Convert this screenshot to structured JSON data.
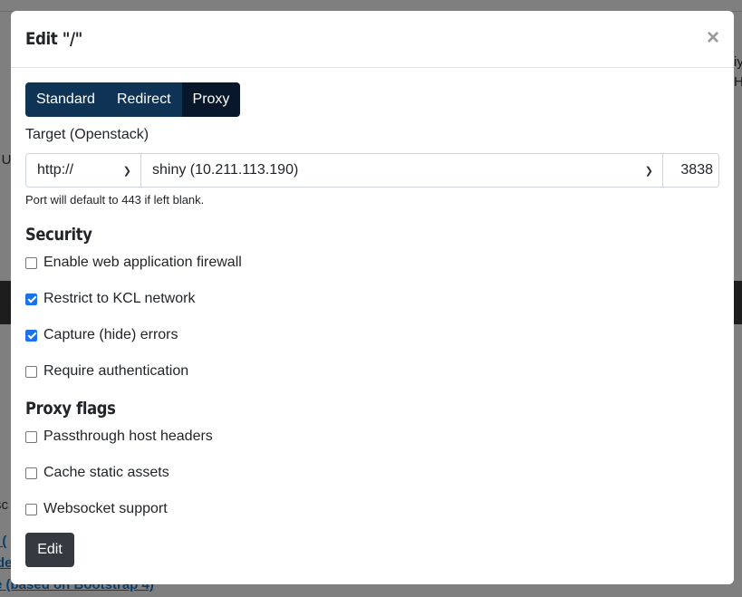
{
  "background": {
    "fragments": [
      "",
      "iy",
      "H",
      "c U",
      "sc",
      "l (",
      "de",
      "e (based on Bootstrap 4)"
    ]
  },
  "modal": {
    "title": "Edit \"/\"",
    "close_glyph": "×",
    "mode_tabs": [
      {
        "label": "Standard",
        "active": false
      },
      {
        "label": "Redirect",
        "active": false
      },
      {
        "label": "Proxy",
        "active": true
      }
    ],
    "target": {
      "label": "Target (Openstack)",
      "scheme": "http://",
      "host": "shiny (10.211.113.190)",
      "port": "3838",
      "help": "Port will default to 443 if left blank."
    },
    "security": {
      "title": "Security",
      "options": [
        {
          "label": "Enable web application firewall",
          "checked": false
        },
        {
          "label": "Restrict to KCL network",
          "checked": true
        },
        {
          "label": "Capture (hide) errors",
          "checked": true
        },
        {
          "label": "Require authentication",
          "checked": false
        }
      ]
    },
    "proxy_flags": {
      "title": "Proxy flags",
      "options": [
        {
          "label": "Passthrough host headers",
          "checked": false
        },
        {
          "label": "Cache static assets",
          "checked": false
        },
        {
          "label": "Websocket support",
          "checked": false
        }
      ]
    },
    "submit_label": "Edit"
  },
  "colors": {
    "primary_segment": "#0e3354",
    "active_segment": "#08182a",
    "checkbox_checked": "#1a73e8",
    "submit_button": "#343a40"
  }
}
